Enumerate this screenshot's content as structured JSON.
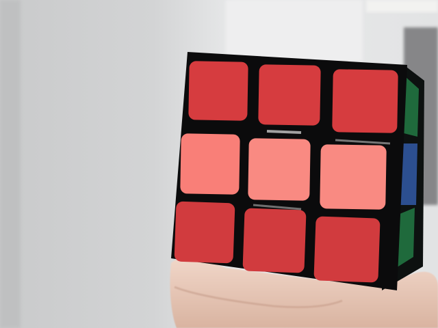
{
  "scene": {
    "subject": "rubiks-cube",
    "held_by": "hand",
    "colors": {
      "background_wall": "#d6d7d8",
      "background_light": "#eeeeef",
      "cube_body": "#0b0b0c",
      "top_row_red": "#d63c3f",
      "middle_row_red": "#f97f78",
      "bottom_row_red": "#d13b3e",
      "side_green": "#1f6a3c",
      "side_blue": "#2c4f90",
      "skin": "#e7c8b8"
    },
    "front_face": {
      "rows": [
        [
          "red",
          "red",
          "red"
        ],
        [
          "red",
          "red",
          "red"
        ],
        [
          "red",
          "red",
          "red"
        ]
      ]
    },
    "side_face_visible": [
      "green",
      "blue",
      "green"
    ]
  }
}
